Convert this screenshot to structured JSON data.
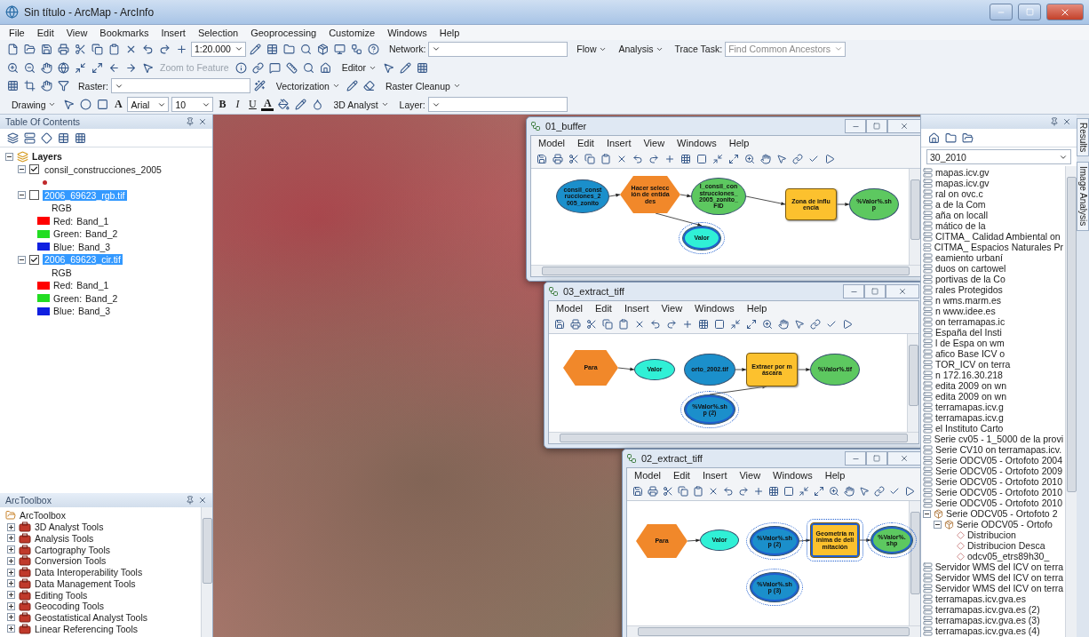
{
  "window": {
    "title": "Sin título - ArcMap - ArcInfo"
  },
  "menu": [
    "File",
    "Edit",
    "View",
    "Bookmarks",
    "Insert",
    "Selection",
    "Geoprocessing",
    "Customize",
    "Windows",
    "Help"
  ],
  "toolbars": [
    {
      "items": [
        {
          "kind": "tools"
        },
        {
          "kind": "combo",
          "value": "1:20.000"
        },
        {
          "kind": "tools"
        },
        {
          "kind": "label",
          "text": "Network:"
        },
        {
          "kind": "combo"
        },
        {
          "kind": "menu",
          "label": "Flow"
        },
        {
          "kind": "menu",
          "label": "Analysis"
        },
        {
          "kind": "label",
          "text": "Trace Task:"
        },
        {
          "kind": "combo",
          "value": "Find Common Ancestors",
          "disabled": true
        }
      ]
    },
    {
      "items": [
        {
          "kind": "tools"
        },
        {
          "kind": "button",
          "label": "Zoom to Feature",
          "disabled": true
        },
        {
          "kind": "tools"
        },
        {
          "kind": "menu",
          "label": "Editor"
        },
        {
          "kind": "tools"
        }
      ]
    },
    {
      "items": [
        {
          "kind": "tools"
        },
        {
          "kind": "label",
          "text": "Raster:"
        },
        {
          "kind": "combo"
        },
        {
          "kind": "tools"
        },
        {
          "kind": "menu",
          "label": "Vectorization"
        },
        {
          "kind": "tools"
        },
        {
          "kind": "menu",
          "label": "Raster Cleanup"
        }
      ]
    },
    {
      "items": [
        {
          "kind": "menu",
          "label": "Drawing"
        },
        {
          "kind": "tools"
        },
        {
          "kind": "textglyph",
          "label": "A"
        },
        {
          "kind": "combo",
          "value": "Arial"
        },
        {
          "kind": "combo",
          "value": "10"
        },
        {
          "kind": "bold",
          "label": "B"
        },
        {
          "kind": "italic",
          "label": "I"
        },
        {
          "kind": "underline",
          "label": "U"
        },
        {
          "kind": "fontcolor",
          "label": "A"
        },
        {
          "kind": "tools"
        },
        {
          "kind": "menu",
          "label": "3D Analyst"
        },
        {
          "kind": "label",
          "text": "Layer:"
        },
        {
          "kind": "combo"
        }
      ]
    }
  ],
  "toc": {
    "title": "Table Of Contents",
    "root": {
      "label": "Layers",
      "expanded": true,
      "children": [
        {
          "label": "consil_construcciones_2005",
          "checked": true,
          "selected": false,
          "expanded": true,
          "legend": [
            {
              "kind": "point",
              "color": "#c0282b"
            }
          ]
        },
        {
          "label": "2006_69623_rgb.tif",
          "checked": false,
          "selected": true,
          "expanded": true,
          "legend_title": "RGB",
          "legend": [
            {
              "kind": "band",
              "color": "#ff0000",
              "label": "Red:",
              "band": "Band_1"
            },
            {
              "kind": "band",
              "color": "#22dd22",
              "label": "Green:",
              "band": "Band_2"
            },
            {
              "kind": "band",
              "color": "#1020e0",
              "label": "Blue:",
              "band": "Band_3"
            }
          ]
        },
        {
          "label": "2006_69623_cir.tif",
          "checked": true,
          "selected": true,
          "expanded": true,
          "legend_title": "RGB",
          "legend": [
            {
              "kind": "band",
              "color": "#ff0000",
              "label": "Red:",
              "band": "Band_1"
            },
            {
              "kind": "band",
              "color": "#22dd22",
              "label": "Green:",
              "band": "Band_2"
            },
            {
              "kind": "band",
              "color": "#1020e0",
              "label": "Blue:",
              "band": "Band_3"
            }
          ]
        }
      ]
    }
  },
  "toolbox": {
    "title": "ArcToolbox",
    "root": "ArcToolbox",
    "items": [
      {
        "label": "3D Analyst Tools",
        "expanded": false
      },
      {
        "label": "Analysis Tools",
        "expanded": false
      },
      {
        "label": "Cartography Tools",
        "expanded": false
      },
      {
        "label": "Conversion Tools",
        "expanded": false
      },
      {
        "label": "Data Interoperability Tools",
        "expanded": false
      },
      {
        "label": "Data Management Tools",
        "expanded": false
      },
      {
        "label": "Editing Tools",
        "expanded": false
      },
      {
        "label": "Geocoding Tools",
        "expanded": false
      },
      {
        "label": "Geostatistical Analyst Tools",
        "expanded": false
      },
      {
        "label": "Linear Referencing Tools",
        "expanded": false
      }
    ]
  },
  "models": [
    {
      "title": "01_buffer",
      "menu": [
        "Model",
        "Edit",
        "Insert",
        "View",
        "Windows",
        "Help"
      ],
      "nodes": [
        {
          "kind": "data",
          "text": "consil_construcciones_2005_zonito",
          "selected": false
        },
        {
          "kind": "iterator",
          "text": "Hacer selección de entidades",
          "selected": false
        },
        {
          "kind": "output",
          "text": "l_consil_construcciones_2005_zonito_FID",
          "selected": false
        },
        {
          "kind": "tool",
          "text": "Zona de influencia",
          "selected": false
        },
        {
          "kind": "output",
          "text": "%Valor%.shp",
          "selected": false
        },
        {
          "kind": "value",
          "text": "Valor",
          "selected": true
        }
      ]
    },
    {
      "title": "03_extract_tiff",
      "menu": [
        "Model",
        "Edit",
        "Insert",
        "View",
        "Windows",
        "Help"
      ],
      "nodes": [
        {
          "kind": "iterator",
          "text": "Para",
          "selected": false
        },
        {
          "kind": "value",
          "text": "Valor",
          "selected": false
        },
        {
          "kind": "data",
          "text": "orto_2002.tif",
          "selected": false
        },
        {
          "kind": "tool",
          "text": "Extraer por máscara",
          "selected": false
        },
        {
          "kind": "output",
          "text": "%Valor%.tif",
          "selected": false
        },
        {
          "kind": "data",
          "text": "%Valor%.shp (2)",
          "selected": true
        }
      ]
    },
    {
      "title": "02_extract_tiff",
      "menu": [
        "Model",
        "Edit",
        "Insert",
        "View",
        "Windows",
        "Help"
      ],
      "nodes": [
        {
          "kind": "iterator",
          "text": "Para",
          "selected": false
        },
        {
          "kind": "value",
          "text": "Valor",
          "selected": false
        },
        {
          "kind": "data",
          "text": "%Valor%.shp (2)",
          "selected": true
        },
        {
          "kind": "tool",
          "text": "Geometría mínima de delimitación",
          "selected": true
        },
        {
          "kind": "output",
          "text": "%Valor%.shp",
          "selected": true
        },
        {
          "kind": "data",
          "text": "%Valor%.shp (3)",
          "selected": true
        }
      ]
    }
  ],
  "catalog": {
    "combo": "30_2010",
    "items": [
      {
        "kind": "service",
        "label": "mapas.icv.gv"
      },
      {
        "kind": "service",
        "label": "mapas.icv.gv"
      },
      {
        "kind": "service",
        "label": "ral on ovc.c"
      },
      {
        "kind": "service",
        "label": "a de la Com"
      },
      {
        "kind": "service",
        "label": "aña on locall"
      },
      {
        "kind": "service",
        "label": "mático de la"
      },
      {
        "kind": "service",
        "label": "CITMA_ Calidad Ambiental on"
      },
      {
        "kind": "service",
        "label": "CITMA_ Espacios Naturales Pr"
      },
      {
        "kind": "service",
        "label": "eamiento urbaní"
      },
      {
        "kind": "service",
        "label": "duos on cartowel"
      },
      {
        "kind": "service",
        "label": "portivas de la Co"
      },
      {
        "kind": "service",
        "label": "rales Protegidos"
      },
      {
        "kind": "service",
        "label": "n wms.marm.es"
      },
      {
        "kind": "service",
        "label": "n www.idee.es"
      },
      {
        "kind": "service",
        "label": "on terramapas.ic"
      },
      {
        "kind": "service",
        "label": "España del Insti"
      },
      {
        "kind": "service",
        "label": "l de Espa on wm"
      },
      {
        "kind": "service",
        "label": "afico Base ICV o"
      },
      {
        "kind": "service",
        "label": "TOR_ICV on terra"
      },
      {
        "kind": "service",
        "label": "n 172.16.30.218"
      },
      {
        "kind": "service",
        "label": "edita 2009 on wn"
      },
      {
        "kind": "service",
        "label": "edita 2009 on wn"
      },
      {
        "kind": "service",
        "label": "terramapas.icv.g"
      },
      {
        "kind": "service",
        "label": "terramapas.icv.g"
      },
      {
        "kind": "service",
        "label": "el Instituto Carto"
      },
      {
        "kind": "service",
        "label": "Serie cv05 - 1_5000 de la provi"
      },
      {
        "kind": "service",
        "label": "Serie CV10 on terramapas.icv."
      },
      {
        "kind": "service",
        "label": "Serie ODCV05 - Ortofoto 2004"
      },
      {
        "kind": "service",
        "label": "Serie ODCV05 - Ortofoto 2009"
      },
      {
        "kind": "service",
        "label": "Serie ODCV05 - Ortofoto 2010"
      },
      {
        "kind": "service",
        "label": "Serie ODCV05 - Ortofoto 2010"
      },
      {
        "kind": "service",
        "label": "Serie ODCV05 - Ortofoto 2010"
      },
      {
        "kind": "group",
        "label": "Serie ODCV05 - Ortofoto 2",
        "expanded": true,
        "children": [
          {
            "kind": "group",
            "label": "Serie ODCV05 - Ortofo",
            "expanded": true,
            "children": [
              {
                "kind": "layer",
                "label": "Distribucion"
              },
              {
                "kind": "layer",
                "label": "Distribucion Desca"
              },
              {
                "kind": "layer",
                "label": "odcv05_etrs89h30_"
              }
            ]
          }
        ]
      },
      {
        "kind": "service",
        "label": "Servidor WMS del ICV on terra"
      },
      {
        "kind": "service",
        "label": "Servidor WMS del ICV on terra"
      },
      {
        "kind": "service",
        "label": "Servidor WMS del ICV on terra"
      },
      {
        "kind": "service",
        "label": "terramapas.icv.gva.es"
      },
      {
        "kind": "service",
        "label": "terramapas.icv.gva.es (2)"
      },
      {
        "kind": "service",
        "label": "terramapas.icv.gva.es (3)"
      },
      {
        "kind": "service",
        "label": "terramapas.icv.gva.es (4)"
      }
    ]
  },
  "side_tabs": [
    {
      "label": "Results"
    },
    {
      "label": "Image Analysis"
    }
  ]
}
